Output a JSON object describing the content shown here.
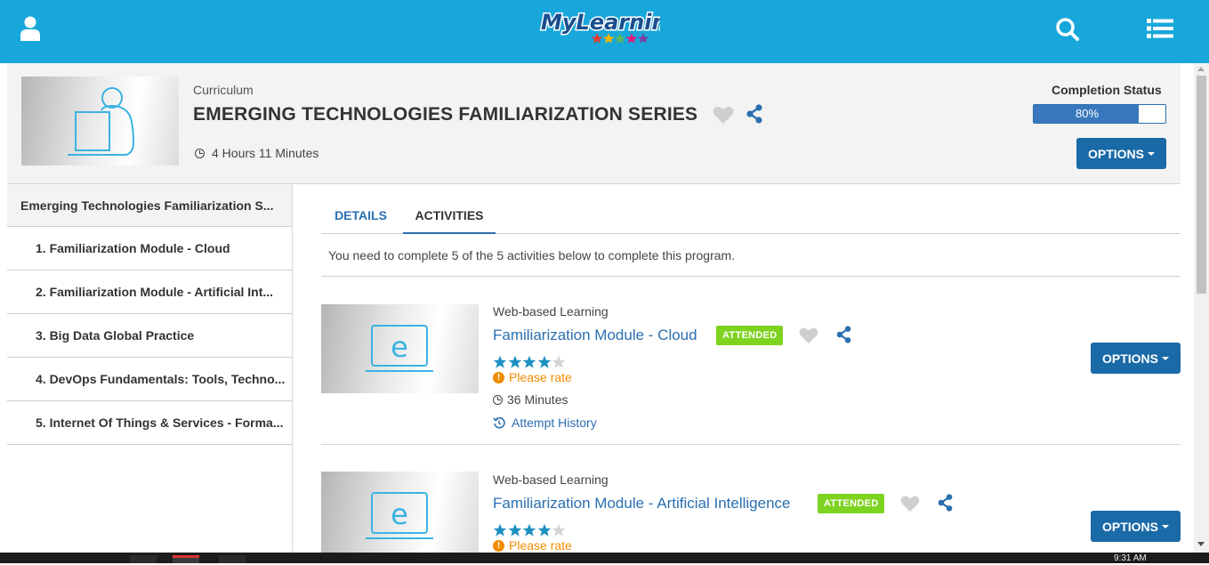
{
  "app": {
    "logo_text": "MyLearning",
    "brand_color": "#17a7db",
    "accent_color": "#1a6aa8",
    "attended_color": "#7ed321",
    "icons": [
      "user-icon",
      "search-icon",
      "list-menu-icon"
    ]
  },
  "curriculum": {
    "type": "Curriculum",
    "title": "EMERGING TECHNOLOGIES FAMILIARIZATION SERIES",
    "duration": "4 Hours 11 Minutes",
    "completion_label": "Completion Status",
    "completion_text": "80%",
    "completion_percent": 80,
    "options_label": "OPTIONS"
  },
  "sidebar": {
    "header": "Emerging Technologies Familiarization S...",
    "items": [
      {
        "label": "1. Familiarization Module - Cloud"
      },
      {
        "label": "2. Familiarization Module - Artificial Int..."
      },
      {
        "label": "3. Big Data Global Practice"
      },
      {
        "label": "4. DevOps Fundamentals: Tools, Techno..."
      },
      {
        "label": "5. Internet Of Things & Services - Forma..."
      }
    ]
  },
  "tabs": [
    {
      "label": "DETAILS"
    },
    {
      "label": "ACTIVITIES"
    }
  ],
  "instruction": "You need to complete 5 of the 5 activities below to complete this program.",
  "activities": [
    {
      "type": "Web-based Learning",
      "title": "Familiarization Module - Cloud",
      "status": "ATTENDED",
      "rating": 4,
      "rating_max": 5,
      "rate_prompt": "Please rate",
      "duration": "36 Minutes",
      "attempt_history": "Attempt History",
      "options_label": "OPTIONS"
    },
    {
      "type": "Web-based Learning",
      "title": "Familiarization Module - Artificial Intelligence",
      "status": "ATTENDED",
      "rating": 4,
      "rating_max": 5,
      "rate_prompt": "Please rate",
      "options_label": "OPTIONS"
    }
  ],
  "taskbar": {
    "time": "9:31 AM"
  }
}
